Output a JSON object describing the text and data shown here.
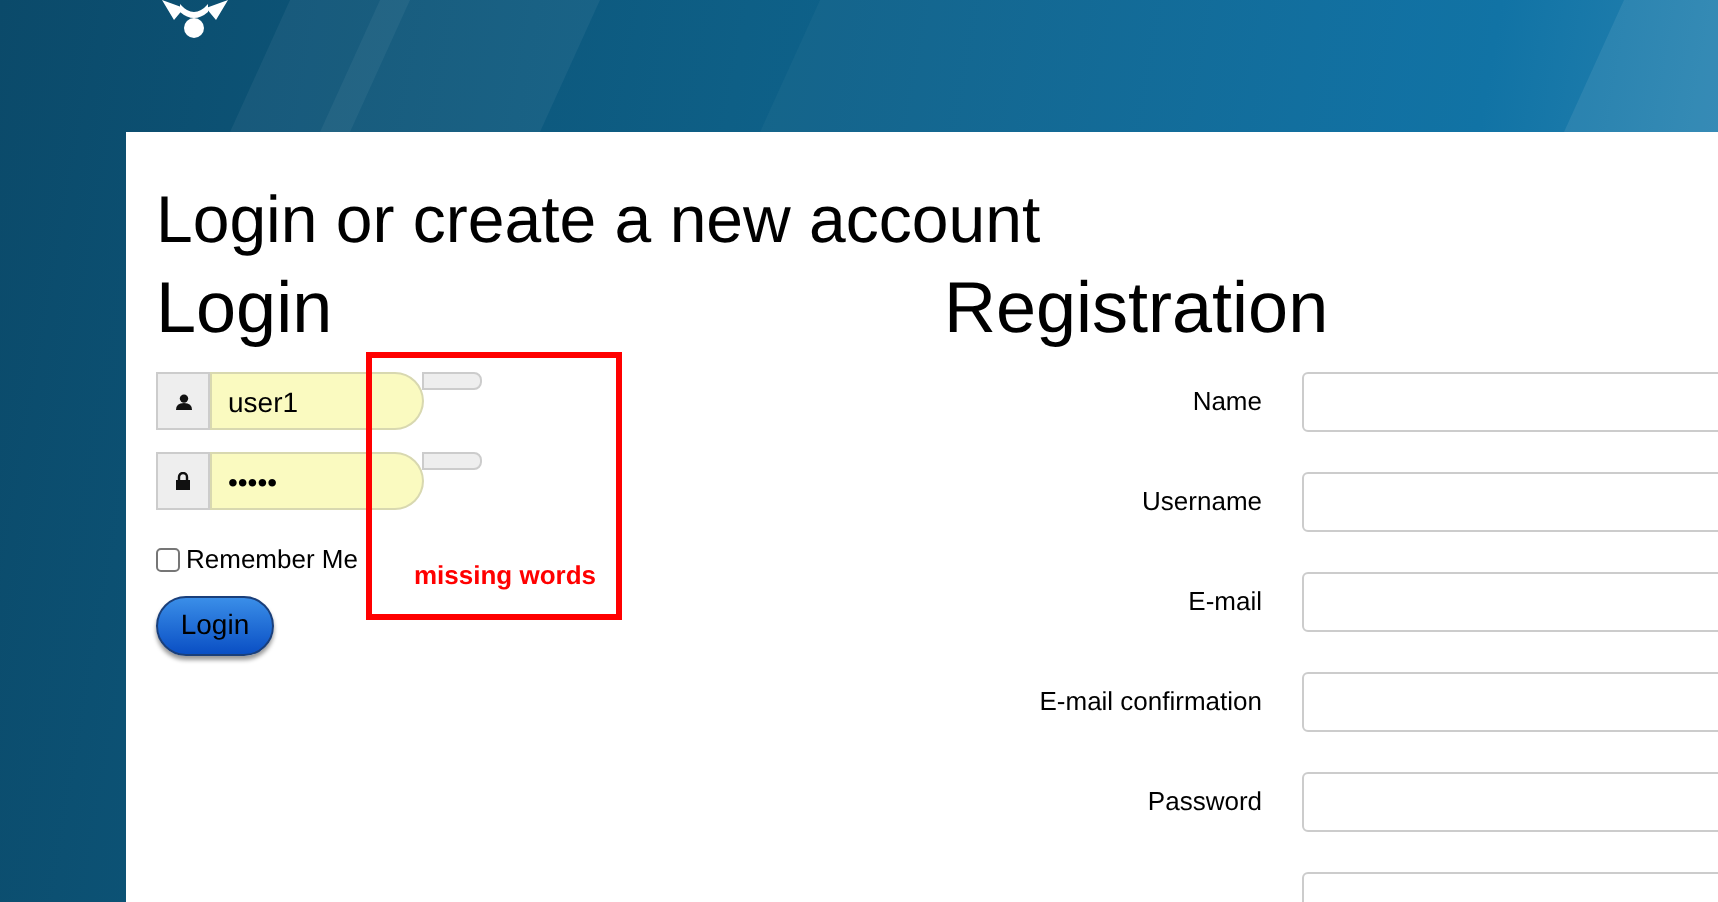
{
  "page_title": "Login or create a new account",
  "login": {
    "heading": "Login",
    "fields": [
      {
        "kind": "user",
        "value": "user1"
      },
      {
        "kind": "lock",
        "value": "•••••"
      }
    ],
    "remember": {
      "label": "Remember Me",
      "checked": false
    },
    "button": "Login"
  },
  "annotation": {
    "text": "missing words"
  },
  "registration": {
    "heading": "Registration",
    "fields": [
      {
        "kind": "labeled",
        "label": "Name"
      },
      {
        "kind": "labeled",
        "label": "Username"
      },
      {
        "kind": "labeled",
        "label": "E-mail"
      },
      {
        "kind": "labeled",
        "label": "E-mail confirmation"
      },
      {
        "kind": "labeled",
        "label": "Password"
      },
      {
        "kind": "input_only"
      }
    ]
  }
}
